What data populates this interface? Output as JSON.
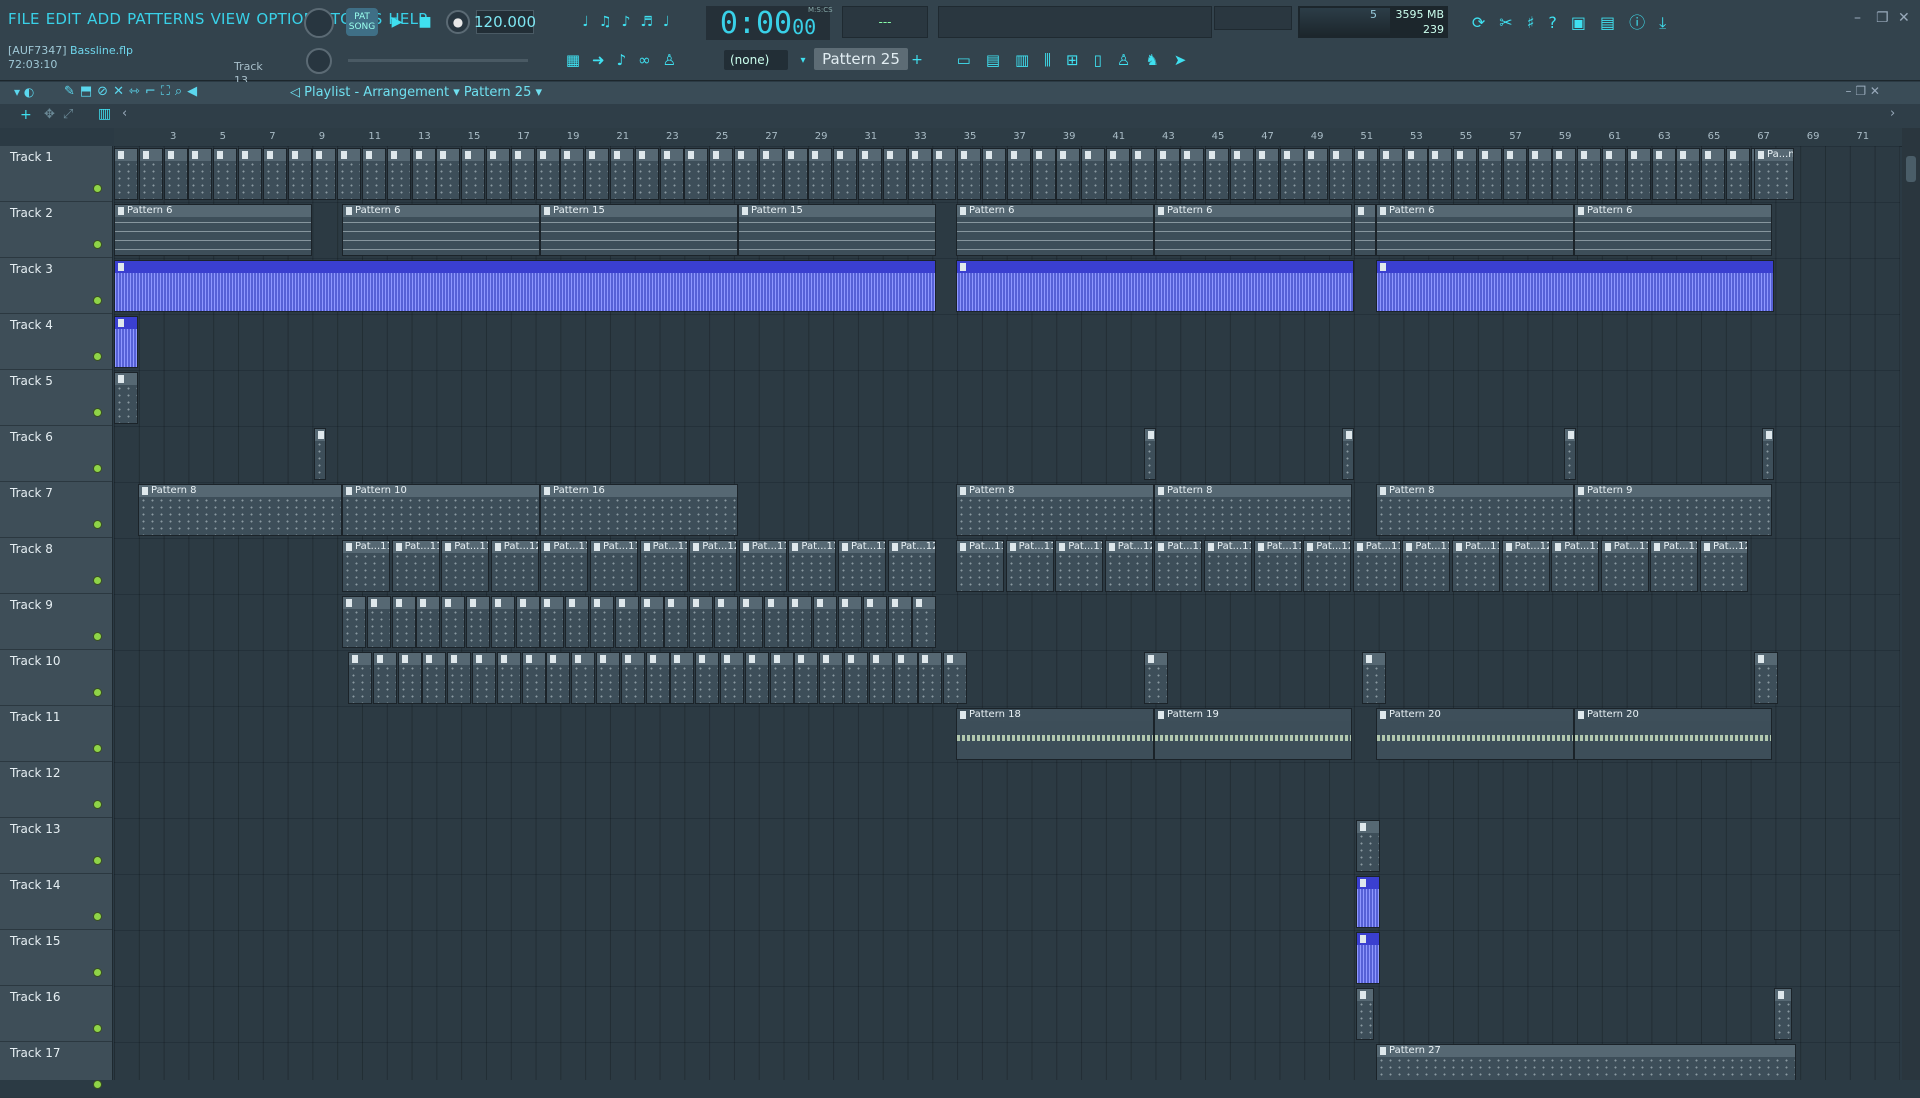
{
  "menu": [
    "FILE",
    "EDIT",
    "ADD",
    "PATTERNS",
    "VIEW",
    "OPTIONS",
    "TOOLS",
    "HELP"
  ],
  "file": {
    "plugin": "[AUF7347]",
    "name": "Bassline.flp",
    "time": "72:03:10",
    "track": "Track 13"
  },
  "transport": {
    "pat": "PAT",
    "song": "SONG",
    "tempo": "120.000",
    "time_main": "0:00",
    "time_sub": "00",
    "time_unit": "M:S:CS",
    "hint": "---"
  },
  "cpu": {
    "poly": "5",
    "mem": "3595 MB",
    "cpu_pct": "239"
  },
  "toolbar": {
    "snap": "(none)",
    "pattern": "Pattern 25",
    "add": "+"
  },
  "playlist": {
    "title": "Playlist - Arrangement",
    "sep": "›",
    "pattern": "Pattern 25"
  },
  "ruler": [
    "3",
    "5",
    "7",
    "9",
    "11",
    "13",
    "15",
    "17",
    "19",
    "21",
    "23",
    "25",
    "27",
    "29",
    "31",
    "33",
    "35",
    "37",
    "39",
    "41",
    "43",
    "45",
    "47",
    "49",
    "51",
    "53",
    "55",
    "57",
    "59",
    "61",
    "63",
    "65",
    "67",
    "69",
    "71"
  ],
  "tracks": [
    "Track 1",
    "Track 2",
    "Track 3",
    "Track 4",
    "Track 5",
    "Track 6",
    "Track 7",
    "Track 8",
    "Track 9",
    "Track 10",
    "Track 11",
    "Track 12",
    "Track 13",
    "Track 14",
    "Track 15",
    "Track 16",
    "Track 17"
  ],
  "clips": {
    "p6": "Pattern 6",
    "p15": "Pattern 15",
    "p8": "Pattern 8",
    "p9": "Pattern 9",
    "p10": "Pattern 10",
    "p16": "Pattern 16",
    "p18": "Pattern 18",
    "p19": "Pattern 19",
    "p20": "Pattern 20",
    "p27": "Pattern 27",
    "pat11": "Pat...11",
    "pat12": "Pat...12",
    "pa4": "Pa...n 4"
  },
  "colors": {
    "accent": "#39d1e8",
    "automation": "#4c58c8",
    "audio_wave": "#cfe6c4"
  }
}
